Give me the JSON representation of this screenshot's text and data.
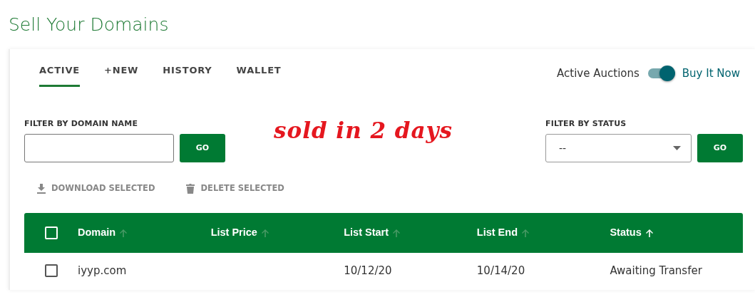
{
  "page_title": "Sell Your Domains",
  "tabs": [
    {
      "label": "ACTIVE",
      "selected": true
    },
    {
      "label": "+NEW",
      "selected": false
    },
    {
      "label": "HISTORY",
      "selected": false
    },
    {
      "label": "WALLET",
      "selected": false
    }
  ],
  "mode_toggle": {
    "left_label": "Active Auctions",
    "right_label": "Buy It Now",
    "on": true
  },
  "annotation": "sold in 2 days",
  "domain_filter": {
    "label": "FILTER BY DOMAIN NAME",
    "button": "GO"
  },
  "status_filter": {
    "label": "FILTER BY STATUS",
    "value": "--",
    "button": "GO"
  },
  "actions": [
    {
      "kind": "download",
      "label": "DOWNLOAD SELECTED",
      "disabled": true
    },
    {
      "kind": "delete",
      "label": "DELETE SELECTED",
      "disabled": true
    }
  ],
  "table": {
    "select_all_checked": false,
    "columns": [
      {
        "label": "Domain",
        "sorted": false
      },
      {
        "label": "List Price",
        "sorted": false
      },
      {
        "label": "List Start",
        "sorted": false
      },
      {
        "label": "List End",
        "sorted": false
      },
      {
        "label": "Status",
        "sorted": true
      }
    ],
    "rows": [
      {
        "checked": false,
        "cells": [
          "iyyp.com",
          "",
          "10/12/20",
          "10/14/20",
          "Awaiting Transfer"
        ]
      }
    ]
  }
}
